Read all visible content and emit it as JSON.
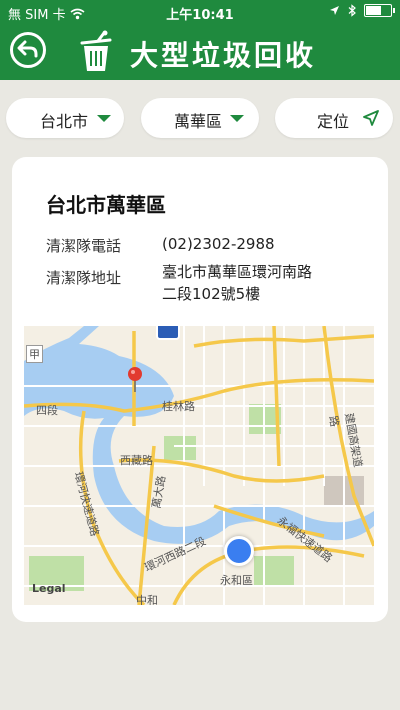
{
  "status": {
    "carrier": "無 SIM 卡",
    "time": "上午10:41"
  },
  "nav": {
    "title": "大型垃圾回收",
    "back_icon": "back-arrow-icon",
    "app_icon": "trash-bin-icon"
  },
  "filters": {
    "city": "台北市",
    "district": "萬華區",
    "locate": "定位",
    "locate_icon": "location-arrow-icon",
    "accent": "#1f8a3e"
  },
  "card": {
    "title": "台北市萬華區",
    "phone_label": "清潔隊電話",
    "phone_value": "(02)2302-2988",
    "address_label": "清潔隊地址",
    "address_line1": "臺北市萬華區環河南路",
    "address_line2": "二段102號5樓"
  },
  "map": {
    "legal": "Legal",
    "labels": [
      "甲",
      "四段",
      "桂林路",
      "西藏路",
      "萬大路",
      "環河西路二段",
      "永和區",
      "環河快速道路",
      "永福快速道路",
      "建國高架道路",
      "中和"
    ]
  }
}
